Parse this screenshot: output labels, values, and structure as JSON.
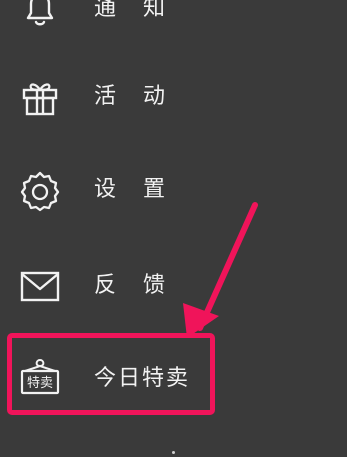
{
  "menu": {
    "items": [
      {
        "label": "通 知",
        "icon": "bell-icon"
      },
      {
        "label": "活 动",
        "icon": "gift-icon"
      },
      {
        "label": "设 置",
        "icon": "gear-icon"
      },
      {
        "label": "反 馈",
        "icon": "envelope-icon"
      },
      {
        "label": "今日特卖",
        "icon": "special-sale-tag-icon",
        "icon_text": "特卖"
      }
    ]
  },
  "annotation": {
    "highlight_color": "#f0145a",
    "arrow_target": "今日特卖"
  },
  "colors": {
    "background": "#3a3a3a",
    "text": "#f2f2f2",
    "icon_stroke": "#f2f2f2",
    "accent": "#f0145a"
  }
}
